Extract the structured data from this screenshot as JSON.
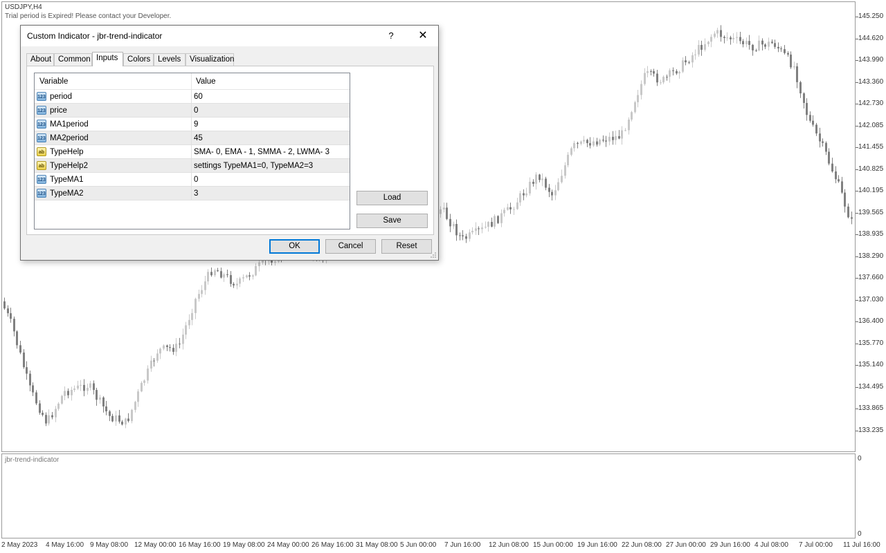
{
  "chart": {
    "symbol_title": "USDJPY,H4",
    "message": "Trial period is Expired! Please contact your Developer.",
    "indicator_window_title": "jbr-trend-indicator",
    "price_labels": [
      "145.250",
      "144.620",
      "143.990",
      "143.360",
      "142.730",
      "142.085",
      "141.455",
      "140.825",
      "140.195",
      "139.565",
      "138.935",
      "138.290",
      "137.660",
      "137.030",
      "136.400",
      "135.770",
      "135.140",
      "134.495",
      "133.865",
      "133.235"
    ],
    "indicator_scale_labels": [
      "0",
      "0"
    ],
    "time_labels": [
      "2 May 2023",
      "4 May 16:00",
      "9 May 08:00",
      "12 May 00:00",
      "16 May 16:00",
      "19 May 08:00",
      "24 May 00:00",
      "26 May 16:00",
      "31 May 08:00",
      "5 Jun 00:00",
      "7 Jun 16:00",
      "12 Jun 08:00",
      "15 Jun 00:00",
      "19 Jun 16:00",
      "22 Jun 08:00",
      "27 Jun 00:00",
      "29 Jun 16:00",
      "4 Jul 08:00",
      "7 Jul 00:00",
      "11 Jul 16:00"
    ],
    "bull_color": "#c8c8c8",
    "bear_color": "#808080"
  },
  "dialog": {
    "title": "Custom Indicator - jbr-trend-indicator",
    "help_label": "?",
    "close_label": "✕",
    "tabs": [
      {
        "label": "About",
        "active": false
      },
      {
        "label": "Common",
        "active": false
      },
      {
        "label": "Inputs",
        "active": true
      },
      {
        "label": "Colors",
        "active": false
      },
      {
        "label": "Levels",
        "active": false
      },
      {
        "label": "Visualization",
        "active": false
      }
    ],
    "grid_headers": {
      "variable": "Variable",
      "value": "Value"
    },
    "rows": [
      {
        "icon": "numeric-icon",
        "icon_text": "123",
        "variable": "period",
        "value": "60"
      },
      {
        "icon": "numeric-icon",
        "icon_text": "123",
        "variable": "price",
        "value": "0"
      },
      {
        "icon": "numeric-icon",
        "icon_text": "123",
        "variable": "MA1period",
        "value": "9"
      },
      {
        "icon": "numeric-icon",
        "icon_text": "123",
        "variable": "MA2period",
        "value": "45"
      },
      {
        "icon": "string-icon",
        "icon_text": "ab",
        "variable": "TypeHelp",
        "value": "SMA- 0, EMA - 1, SMMA - 2, LWMA- 3"
      },
      {
        "icon": "string-icon",
        "icon_text": "ab",
        "variable": "TypeHelp2",
        "value": "settings TypeMA1=0, TypeMA2=3"
      },
      {
        "icon": "numeric-icon",
        "icon_text": "123",
        "variable": "TypeMA1",
        "value": "0"
      },
      {
        "icon": "numeric-icon",
        "icon_text": "123",
        "variable": "TypeMA2",
        "value": "3"
      }
    ],
    "buttons": {
      "load": "Load",
      "save": "Save",
      "ok": "OK",
      "cancel": "Cancel",
      "reset": "Reset"
    }
  }
}
